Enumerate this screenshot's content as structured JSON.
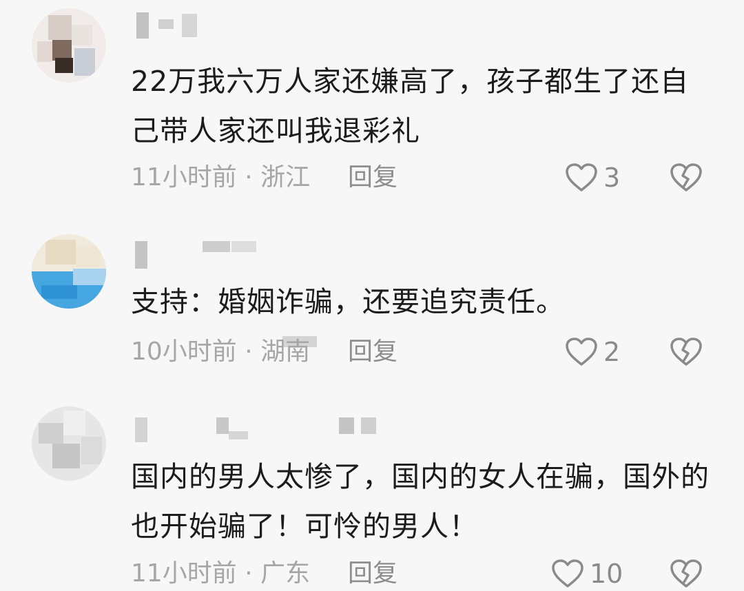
{
  "comments": [
    {
      "text": "22万我六万人家还嫌高了，孩子都生了还自己带人家还叫我退彩礼",
      "time": "11小时前",
      "separator": "·",
      "location": "浙江",
      "reply_label": "回复",
      "likes": "3",
      "avatar_colors": [
        "#efe7e4",
        "#d9cfc9",
        "#8c7a6f",
        "#3b2f29",
        "#cfd3d8",
        "#bfc4cc"
      ]
    },
    {
      "text": "支持：婚姻诈骗，还要追究责任。",
      "time": "10小时前",
      "separator": "·",
      "location": "湖南",
      "reply_label": "回复",
      "likes": "2",
      "avatar_colors": [
        "#f0eadc",
        "#e8dcc4",
        "#5fb4e6",
        "#3da0de",
        "#d9e8f2",
        "#a8d2ee"
      ]
    },
    {
      "text": "国内的男人太惨了，国内的女人在骗，国外的也开始骗了！可怜的男人！",
      "time": "11小时前",
      "separator": "·",
      "location": "广东",
      "reply_label": "回复",
      "likes": "10",
      "avatar_colors": [
        "#e4e4e4",
        "#d2d2d2",
        "#c4c4c4",
        "#ececec",
        "#dadada",
        "#cfcfcf"
      ]
    }
  ],
  "icons": {
    "like": "heart-outline-icon",
    "dislike": "broken-heart-icon"
  },
  "colors": {
    "text": "#1c1c1c",
    "meta": "#a6a6a6",
    "icon": "#8a8a8a",
    "background": "#f7f7f7"
  }
}
